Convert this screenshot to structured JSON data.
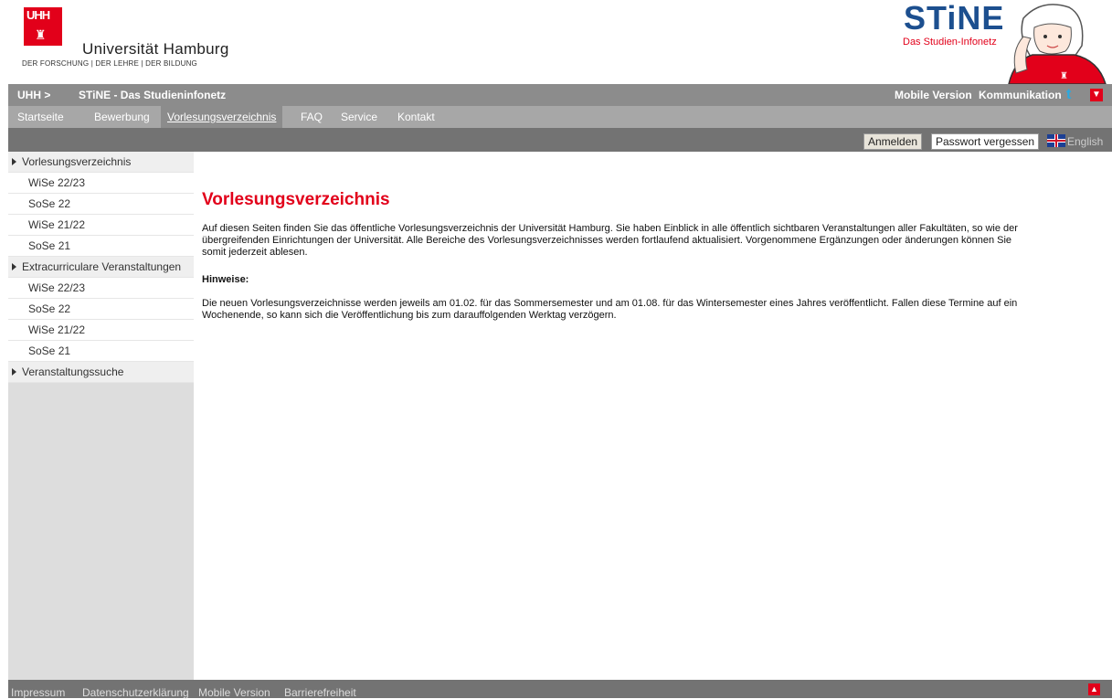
{
  "header": {
    "logo_text": "UHH",
    "uni_name": "Universität Hamburg",
    "uni_subtitle": "DER FORSCHUNG | DER LEHRE | DER BILDUNG",
    "stine_title": "STiNE",
    "stine_subtitle": "Das Studien-Infonetz"
  },
  "topbar": {
    "uhh": "UHH >",
    "breadcrumb": "STiNE - Das Studieninfonetz",
    "mobile": "Mobile Version",
    "kommunikation": "Kommunikation"
  },
  "nav": {
    "items": [
      "Startseite",
      "Bewerbung",
      "Vorlesungsverzeichnis",
      "FAQ",
      "Service",
      "Kontakt"
    ],
    "active": "Vorlesungsverzeichnis"
  },
  "login": {
    "anmelden": "Anmelden",
    "passwort": "Passwort vergessen",
    "english": "English"
  },
  "sidebar": {
    "groups": [
      {
        "label": "Vorlesungsverzeichnis",
        "items": [
          "WiSe 22/23",
          "SoSe 22",
          "WiSe 21/22",
          "SoSe 21"
        ]
      },
      {
        "label": "Extracurriculare Veranstaltungen",
        "items": [
          "WiSe 22/23",
          "SoSe 22",
          "WiSe 21/22",
          "SoSe 21"
        ]
      },
      {
        "label": "Veranstaltungssuche",
        "items": []
      }
    ]
  },
  "content": {
    "title": "Vorlesungsverzeichnis",
    "intro": "Auf diesen Seiten finden Sie das öffentliche Vorlesungsverzeichnis der Universität Hamburg. Sie haben Einblick in alle öffentlich sichtbaren Veranstaltungen aller Fakultäten, so wie der übergreifenden Einrichtungen der Universität. Alle Bereiche des Vorlesungsverzeichnisses werden fortlaufend aktualisiert. Vorgenommene Ergänzungen oder änderungen können Sie somit jederzeit ablesen.",
    "hint_title": "Hinweise:",
    "hint_text": "Die neuen Vorlesungsverzeichnisse werden jeweils am 01.02. für das Sommersemester und am 01.08. für das Wintersemester eines Jahres veröffentlicht. Fallen diese Termine auf ein Wochenende, so kann sich die Veröffentlichung bis zum darauffolgenden Werktag verzögern."
  },
  "footer": {
    "links": [
      "Impressum",
      "Datenschutzerklärung",
      "Mobile Version",
      "Barrierefreiheit"
    ]
  },
  "colors": {
    "brand_red": "#e2001a",
    "stine_blue": "#1c4f8f",
    "bar_dark": "#737373",
    "bar_mid": "#8c8c8c",
    "bar_light": "#a7a7a7"
  }
}
